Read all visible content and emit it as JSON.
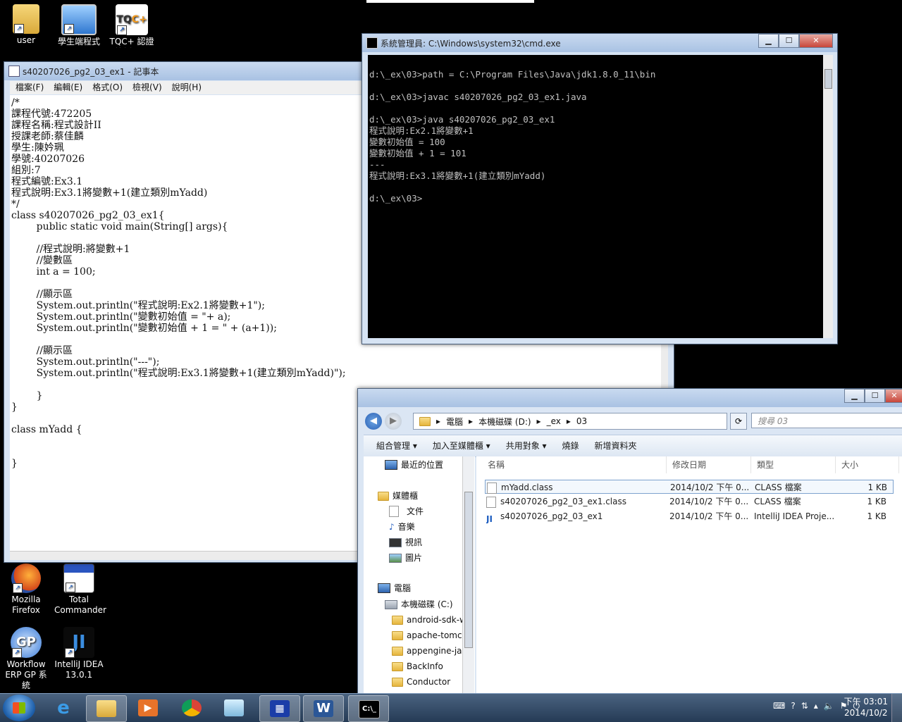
{
  "desktop": {
    "icons": [
      {
        "label": "user"
      },
      {
        "label": "學生端程式"
      },
      {
        "label": "TQC+ 認證\n範例題目"
      },
      {
        "label": "Mozilla\nFirefox"
      },
      {
        "label": "Total\nCommander"
      },
      {
        "label": "Workflow\nERP GP 系統"
      },
      {
        "label": "IntelliJ IDEA\n13.0.1"
      }
    ]
  },
  "notepad": {
    "title": "s40207026_pg2_03_ex1 - 記事本",
    "menu": [
      "檔案(F)",
      "編輯(E)",
      "格式(O)",
      "檢視(V)",
      "說明(H)"
    ],
    "content": "/*\n課程代號:472205\n課程名稱:程式設計II\n授課老師:蔡佳麟\n學生:陳妗珮\n學號:40207026\n組別:7\n程式編號:Ex3.1\n程式說明:Ex3.1將變數+1(建立類別mYadd)\n*/\nclass s40207026_pg2_03_ex1{\n        public static void main(String[] args){\n\n        //程式說明:將變數+1\n        //變數區\n        int a = 100;\n\n        //顯示區\n        System.out.println(\"程式說明:Ex2.1將變數+1\");\n        System.out.println(\"變數初始值 = \"+ a);\n        System.out.println(\"變數初始值 + 1 = \" + (a+1));\n\n        //顯示區\n        System.out.println(\"---\");\n        System.out.println(\"程式說明:Ex3.1將變數+1(建立類別mYadd)\");\n\n        }\n}\n\nclass mYadd {\n\n\n}"
  },
  "cmd": {
    "title": "系統管理員: C:\\Windows\\system32\\cmd.exe",
    "output": "\nd:\\_ex\\03>path = C:\\Program Files\\Java\\jdk1.8.0_11\\bin\n\nd:\\_ex\\03>javac s40207026_pg2_03_ex1.java\n\nd:\\_ex\\03>java s40207026_pg2_03_ex1\n程式說明:Ex2.1將變數+1\n變數初始值 = 100\n變數初始值 + 1 = 101\n---\n程式說明:Ex3.1將變數+1(建立類別mYadd)\n\nd:\\_ex\\03>"
  },
  "explorer": {
    "breadcrumb": [
      "電腦",
      "本機磁碟 (D:)",
      "_ex",
      "03"
    ],
    "search_placeholder": "搜尋 03",
    "toolbar": [
      "組合管理 ▾",
      "加入至媒體櫃 ▾",
      "共用對象 ▾",
      "燒錄",
      "新增資料夾"
    ],
    "nav": {
      "recent": "最近的位置",
      "libraries": "媒體櫃",
      "documents": "文件",
      "music": "音樂",
      "videos": "視訊",
      "pictures": "圖片",
      "computer": "電腦",
      "drive_c": "本機磁碟 (C:)",
      "folders": [
        "android-sdk-w",
        "apache-tomca",
        "appengine-jav",
        "BackInfo",
        "Conductor"
      ]
    },
    "columns": [
      "名稱",
      "修改日期",
      "類型",
      "大小"
    ],
    "files": [
      {
        "name": "mYadd.class",
        "date": "2014/10/2 下午 0...",
        "type": "CLASS 檔案",
        "size": "1 KB"
      },
      {
        "name": "s40207026_pg2_03_ex1.class",
        "date": "2014/10/2 下午 0...",
        "type": "CLASS 檔案",
        "size": "1 KB"
      },
      {
        "name": "s40207026_pg2_03_ex1",
        "date": "2014/10/2 下午 0...",
        "type": "IntelliJ IDEA Proje...",
        "size": "1 KB"
      }
    ]
  },
  "taskbar": {
    "time": "下午 03:01",
    "date": "2014/10/2"
  }
}
